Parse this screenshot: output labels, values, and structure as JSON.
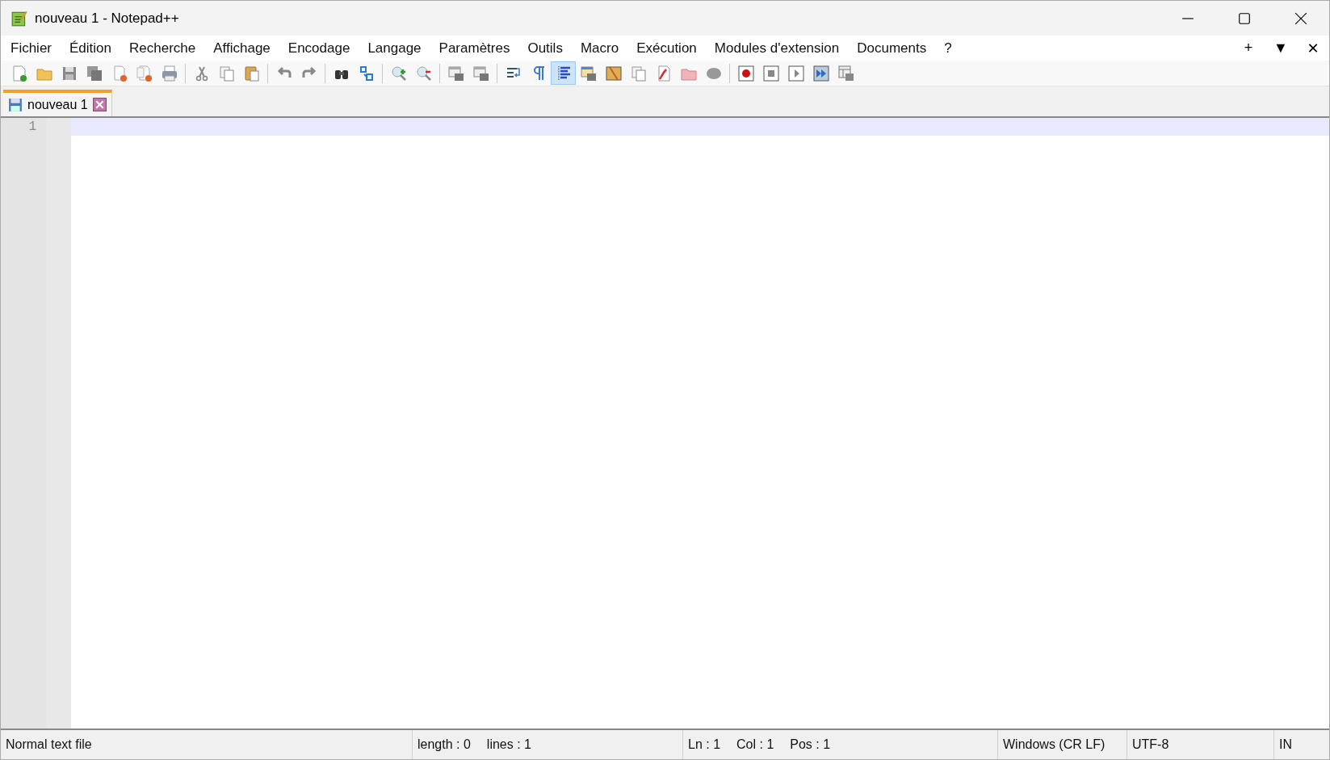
{
  "window": {
    "title": "nouveau 1 - Notepad++"
  },
  "menu": [
    "Fichier",
    "Édition",
    "Recherche",
    "Affichage",
    "Encodage",
    "Langage",
    "Paramètres",
    "Outils",
    "Macro",
    "Exécution",
    "Modules d'extension",
    "Documents",
    "?"
  ],
  "menu_controls": [
    "+",
    "▼",
    "✕"
  ],
  "toolbar": {
    "indent_guide_button": {
      "selected": true
    }
  },
  "tabs": [
    {
      "label": "nouveau 1",
      "selected": true
    }
  ],
  "editor": {
    "line_numbers": [
      "1"
    ]
  },
  "status_bar": [
    {
      "texts": [
        "Normal text file"
      ]
    },
    {
      "texts": [
        "length : 0",
        "lines : 1"
      ]
    },
    {
      "texts": [
        "Ln : 1",
        "Col : 1",
        "Pos : 1"
      ]
    },
    {
      "texts": [
        "Windows (CR LF)"
      ]
    },
    {
      "texts": [
        "UTF-8"
      ]
    },
    {
      "texts": [
        "IN"
      ]
    }
  ]
}
